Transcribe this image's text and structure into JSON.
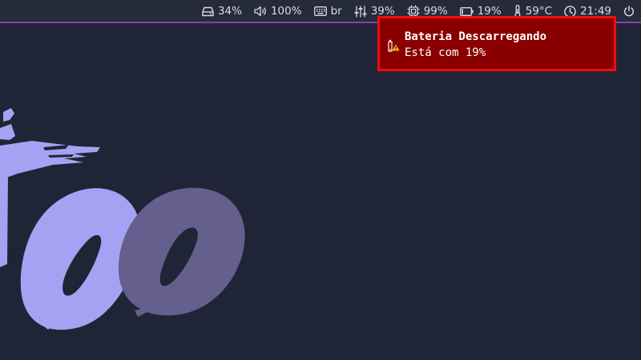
{
  "statusbar": {
    "disk": {
      "icon": "disk-icon",
      "value": "34%"
    },
    "volume": {
      "icon": "volume-icon",
      "value": "100%"
    },
    "keyboard": {
      "icon": "keyboard-icon",
      "value": "br"
    },
    "mixer": {
      "icon": "sliders-icon",
      "value": "39%"
    },
    "cpu": {
      "icon": "cpu-icon",
      "value": "99%"
    },
    "battery": {
      "icon": "battery-icon",
      "value": "19%"
    },
    "temperature": {
      "icon": "thermometer-icon",
      "value": "59°C"
    },
    "clock": {
      "icon": "clock-icon",
      "value": "21:49"
    },
    "power": {
      "icon": "power-icon"
    }
  },
  "notification": {
    "icon": "battery-warning-icon",
    "summary": "Bateria Descarregando",
    "body": "Está com 19%"
  },
  "colors": {
    "background": "#1f2536",
    "bar_background": "#262b3b",
    "bar_accent": "#8b3fb3",
    "notification_background": "#8a0000",
    "notification_border": "#f50d0d",
    "wallpaper_light": "#a6a2f3",
    "wallpaper_dark": "#645f8d"
  }
}
